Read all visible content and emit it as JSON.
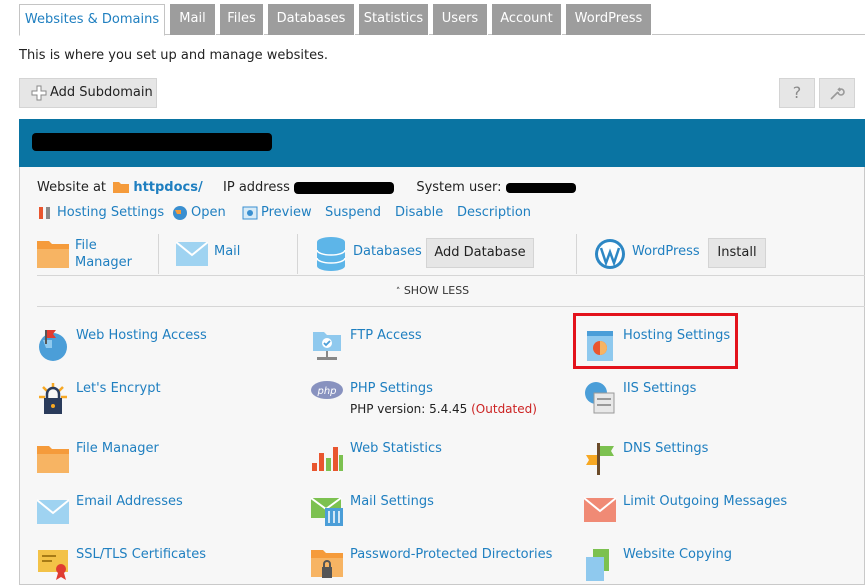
{
  "tabs": [
    {
      "label": "Websites & Domains",
      "active": true
    },
    {
      "label": "Mail"
    },
    {
      "label": "Files"
    },
    {
      "label": "Databases"
    },
    {
      "label": "Statistics"
    },
    {
      "label": "Users"
    },
    {
      "label": "Account"
    },
    {
      "label": "WordPress"
    }
  ],
  "intro": "This is where you set up and manage websites.",
  "toolbar": {
    "add_subdomain": "Add Subdomain",
    "help_icon": "?"
  },
  "domain": {
    "website_at_label": "Website at",
    "docroot": "httpdocs/",
    "ip_label": "IP address",
    "system_user_label": "System user:",
    "actions": [
      "Hosting Settings",
      "Open",
      "Preview",
      "Suspend",
      "Disable",
      "Description"
    ],
    "quick": {
      "file_manager": "File Manager",
      "mail": "Mail",
      "databases": "Databases",
      "add_database": "Add Database",
      "wordpress": "WordPress",
      "install": "Install"
    },
    "show_less": "SHOW LESS",
    "tools": {
      "web_hosting_access": "Web Hosting Access",
      "ftp_access": "FTP Access",
      "hosting_settings": "Hosting Settings",
      "lets_encrypt": "Let's Encrypt",
      "php_settings": "PHP Settings",
      "php_version": "PHP version: 5.4.45",
      "php_outdated": "(Outdated)",
      "iis_settings": "IIS Settings",
      "file_manager": "File Manager",
      "web_statistics": "Web Statistics",
      "dns_settings": "DNS Settings",
      "email_addresses": "Email Addresses",
      "mail_settings": "Mail Settings",
      "limit_outgoing": "Limit Outgoing Messages",
      "ssl_tls": "SSL/TLS Certificates",
      "password_protected": "Password-Protected Directories",
      "website_copying": "Website Copying"
    }
  },
  "colors": {
    "accent": "#1f7fc0",
    "header": "#0a74a2",
    "highlight": "#e3121c",
    "tab_inactive": "#9d9d9d"
  }
}
